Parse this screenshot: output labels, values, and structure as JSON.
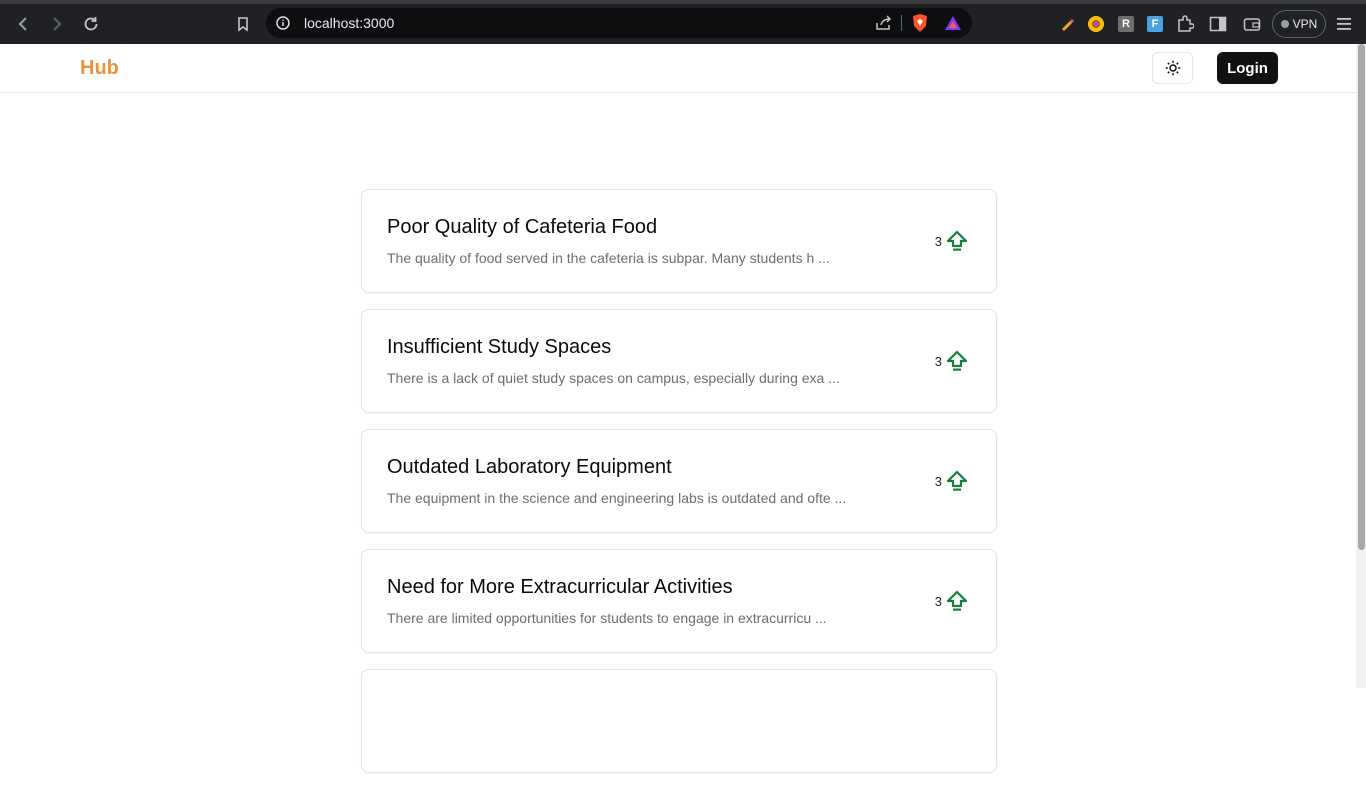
{
  "browser": {
    "url": "localhost:3000",
    "vpn_label": "VPN"
  },
  "header": {
    "logo": "Hub",
    "login_label": "Login",
    "logo_color": "#f0903f"
  },
  "issues": [
    {
      "title": "Poor Quality of Cafeteria Food",
      "description": "The quality of food served in the cafeteria is subpar. Many students h ...",
      "votes": "3"
    },
    {
      "title": "Insufficient Study Spaces",
      "description": "There is a lack of quiet study spaces on campus, especially during exa ...",
      "votes": "3"
    },
    {
      "title": "Outdated Laboratory Equipment",
      "description": "The equipment in the science and engineering labs is outdated and ofte ...",
      "votes": "3"
    },
    {
      "title": "Need for More Extracurricular Activities",
      "description": "There are limited opportunities for students to engage in extracurricu ...",
      "votes": "3"
    },
    {
      "title": "",
      "description": "",
      "votes": ""
    }
  ],
  "colors": {
    "upvote": "#15803d"
  }
}
